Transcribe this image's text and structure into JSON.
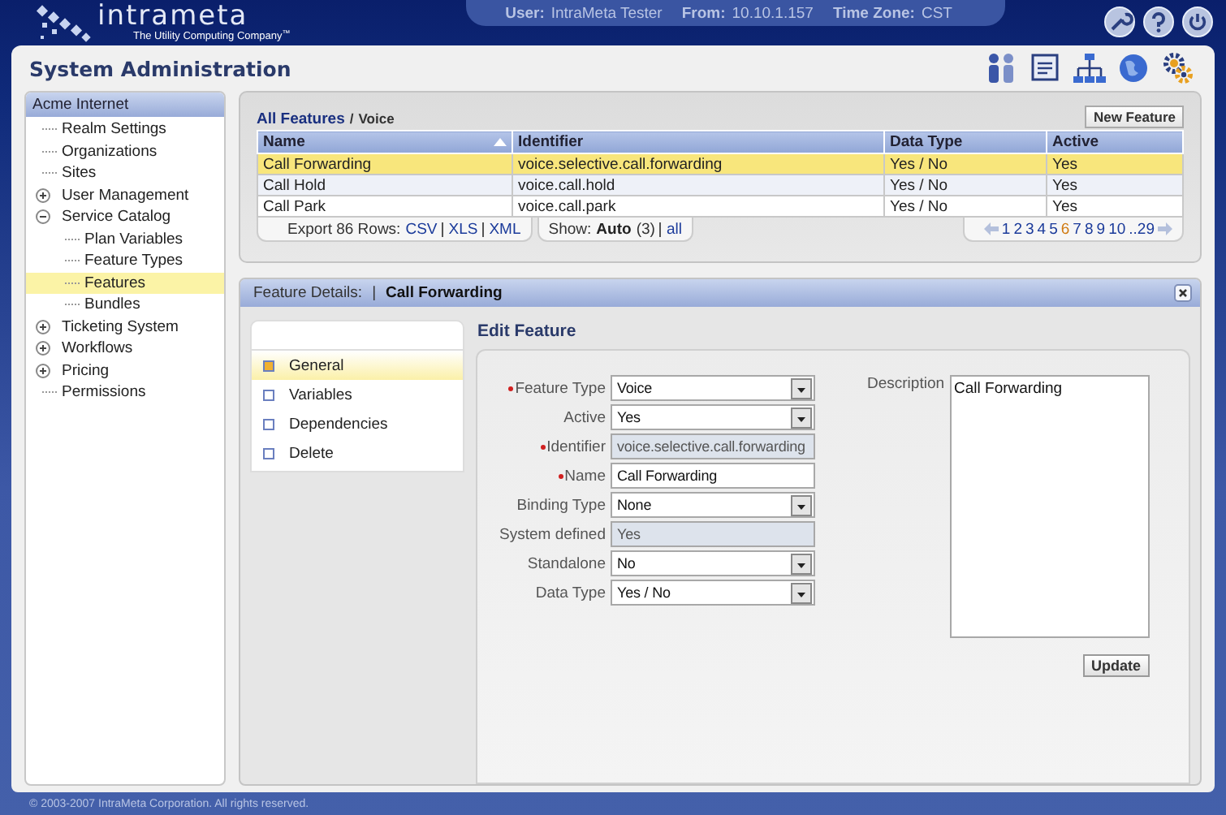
{
  "header": {
    "logo": {
      "name": "intrameta",
      "tagline": "The Utility Computing Company",
      "mark": "™"
    },
    "session": [
      {
        "label": "User:",
        "value": "IntraMeta Tester"
      },
      {
        "label": "From:",
        "value": "10.10.1.157"
      },
      {
        "label": "Time Zone:",
        "value": "CST"
      }
    ]
  },
  "page_title": "System Administration",
  "sidebar": {
    "title": "Acme Internet",
    "items": [
      {
        "label": "Realm Settings",
        "selected": false
      },
      {
        "label": "Organizations",
        "selected": false
      },
      {
        "label": "Sites",
        "selected": false
      },
      {
        "label": "User Management",
        "selected": false,
        "expanded": false
      },
      {
        "label": "Service Catalog",
        "selected": false,
        "expanded": true,
        "children": [
          {
            "label": "Plan Variables",
            "selected": false
          },
          {
            "label": "Feature Types",
            "selected": false
          },
          {
            "label": "Features",
            "selected": true
          },
          {
            "label": "Bundles",
            "selected": false
          }
        ]
      },
      {
        "label": "Ticketing System",
        "selected": false,
        "expanded": false
      },
      {
        "label": "Workflows",
        "selected": false,
        "expanded": false
      },
      {
        "label": "Pricing",
        "selected": false,
        "expanded": false
      },
      {
        "label": "Permissions",
        "selected": false
      }
    ]
  },
  "grid": {
    "breadcrumb": {
      "link": "All Features",
      "separator": "/",
      "current": "Voice"
    },
    "new_button": "New Feature",
    "columns": [
      {
        "label": "Name",
        "sorted": true
      },
      {
        "label": "Identifier",
        "sorted": false
      },
      {
        "label": "Data Type",
        "sorted": false
      },
      {
        "label": "Active",
        "sorted": false
      }
    ],
    "rows": [
      {
        "cells": [
          "Call Forwarding",
          "voice.selective.call.forwarding",
          "Yes / No",
          "Yes"
        ],
        "selected": true
      },
      {
        "cells": [
          "Call Hold",
          "voice.call.hold",
          "Yes / No",
          "Yes"
        ],
        "selected": false
      },
      {
        "cells": [
          "Call Park",
          "voice.call.park",
          "Yes / No",
          "Yes"
        ],
        "selected": false
      }
    ],
    "export": {
      "label": "Export 86 Rows:",
      "links": [
        "CSV",
        "XLS",
        "XML"
      ]
    },
    "show": {
      "label": "Show:",
      "value": "Auto",
      "count": "(3)",
      "link": "all"
    },
    "pages": [
      {
        "label": "1",
        "selected": false
      },
      {
        "label": "2",
        "selected": false
      },
      {
        "label": "3",
        "selected": false
      },
      {
        "label": "4",
        "selected": false
      },
      {
        "label": "5",
        "selected": false
      },
      {
        "label": "6",
        "selected": true
      },
      {
        "label": "7",
        "selected": false
      },
      {
        "label": "8",
        "selected": false
      },
      {
        "label": "9",
        "selected": false
      },
      {
        "label": "10",
        "selected": false
      },
      {
        "label": "..29",
        "selected": false
      }
    ]
  },
  "details": {
    "label": "Feature Details:",
    "separator": "|",
    "title": "Call Forwarding",
    "tabs": [
      {
        "label": "General",
        "selected": true
      },
      {
        "label": "Variables",
        "selected": false
      },
      {
        "label": "Dependencies",
        "selected": false
      },
      {
        "label": "Delete",
        "selected": false
      }
    ],
    "section_title": "Edit Feature",
    "fields": [
      {
        "label": "Feature Type",
        "required": true,
        "kind": "select",
        "value": "Voice"
      },
      {
        "label": "Active",
        "required": false,
        "kind": "select",
        "value": "Yes"
      },
      {
        "label": "Identifier",
        "required": true,
        "kind": "readonly",
        "value": "voice.selective.call.forwarding"
      },
      {
        "label": "Name",
        "required": true,
        "kind": "text",
        "value": "Call Forwarding"
      },
      {
        "label": "Binding Type",
        "required": false,
        "kind": "select",
        "value": "None"
      },
      {
        "label": "System defined",
        "required": false,
        "kind": "readonly",
        "value": "Yes"
      },
      {
        "label": "Standalone",
        "required": false,
        "kind": "select",
        "value": "No"
      },
      {
        "label": "Data Type",
        "required": false,
        "kind": "select",
        "value": "Yes / No"
      }
    ],
    "description": {
      "label": "Description",
      "value": "Call Forwarding"
    },
    "update_button": "Update"
  },
  "footer": "© 2003-2007 IntraMeta Corporation.  All rights reserved."
}
